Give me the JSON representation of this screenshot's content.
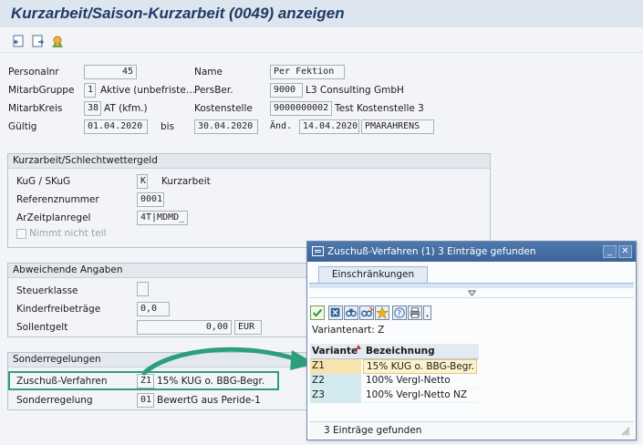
{
  "window": {
    "title": "Kurzarbeit/Saison-Kurzarbeit (0049) anzeigen"
  },
  "toolbar": {
    "icons": [
      "previous-record-icon",
      "next-record-icon",
      "overview-icon"
    ]
  },
  "header": {
    "personalnr": {
      "label": "Personalnr",
      "value": "45"
    },
    "name": {
      "label": "Name",
      "value": "Per Fektion"
    },
    "mitarbgruppe": {
      "label": "MitarbGruppe",
      "code": "1",
      "text": "Aktive (unbefriste…"
    },
    "persber": {
      "label": "PersBer.",
      "code": "9000",
      "text": "L3 Consulting GmbH"
    },
    "mitarbkreis": {
      "label": "MitarbKreis",
      "code": "38",
      "text": "AT (kfm.)"
    },
    "kostenstelle": {
      "label": "Kostenstelle",
      "code": "9000000002",
      "text": "Test Kostenstelle 3"
    },
    "gueltig": {
      "label": "Gültig",
      "from": "01.04.2020",
      "bis_label": "bis",
      "to": "30.04.2020"
    },
    "aend": {
      "label": "Änd.",
      "date": "14.04.2020",
      "user": "PMARAHRENS"
    }
  },
  "group_kug": {
    "title": "Kurzarbeit/Schlechtwettergeld",
    "kug": {
      "label": "KuG / SKuG",
      "code": "K",
      "text": "Kurzarbeit"
    },
    "referenznummer": {
      "label": "Referenznummer",
      "value": "0001"
    },
    "arzeitplanregel": {
      "label": "ArZeitplanregel",
      "value": "4T|MDMD_"
    },
    "nimmt_nicht_teil": {
      "label": "Nimmt nicht teil",
      "checked": false
    }
  },
  "group_abw": {
    "title": "Abweichende Angaben",
    "steuerklasse": {
      "label": "Steuerklasse",
      "value": ""
    },
    "kinderfreibetraege": {
      "label": "Kinderfreibeträge",
      "value": "0,0"
    },
    "sollentgelt": {
      "label": "Sollentgelt",
      "value": "0,00",
      "currency": "EUR"
    }
  },
  "group_sonder": {
    "title": "Sonderregelungen",
    "zuschuss": {
      "label": "Zuschuß-Verfahren",
      "code": "Z1",
      "text": "15% KUG o. BBG-Begr."
    },
    "sonderregelung": {
      "label": "Sonderregelung",
      "code": "01",
      "text": "BewertG aus Peride-1"
    }
  },
  "popup": {
    "title": "Zuschuß-Verfahren (1)   3 Einträge gefunden",
    "minimize": "_",
    "close": "✕",
    "tab": "Einschränkungen",
    "toolbar_icons": [
      "accept-icon",
      "cancel-icon",
      "find-icon",
      "find-next-icon",
      "favorites-icon",
      "help-icon",
      "print-icon"
    ],
    "variantenart": "Variantenart: Z",
    "columns": [
      "Variante",
      "Bezeichnung"
    ],
    "rows": [
      {
        "code": "Z1",
        "text": "15% KUG o. BBG-Begr.",
        "selected": true
      },
      {
        "code": "Z2",
        "text": "100% Vergl-Netto",
        "selected": false
      },
      {
        "code": "Z3",
        "text": "100% Vergl-Netto NZ",
        "selected": false
      }
    ],
    "footer": "3 Einträge gefunden"
  },
  "colors": {
    "accent_arrow": "#2e9e7a",
    "popup_title": "#3b6498",
    "selection": "#f7e3ad"
  }
}
